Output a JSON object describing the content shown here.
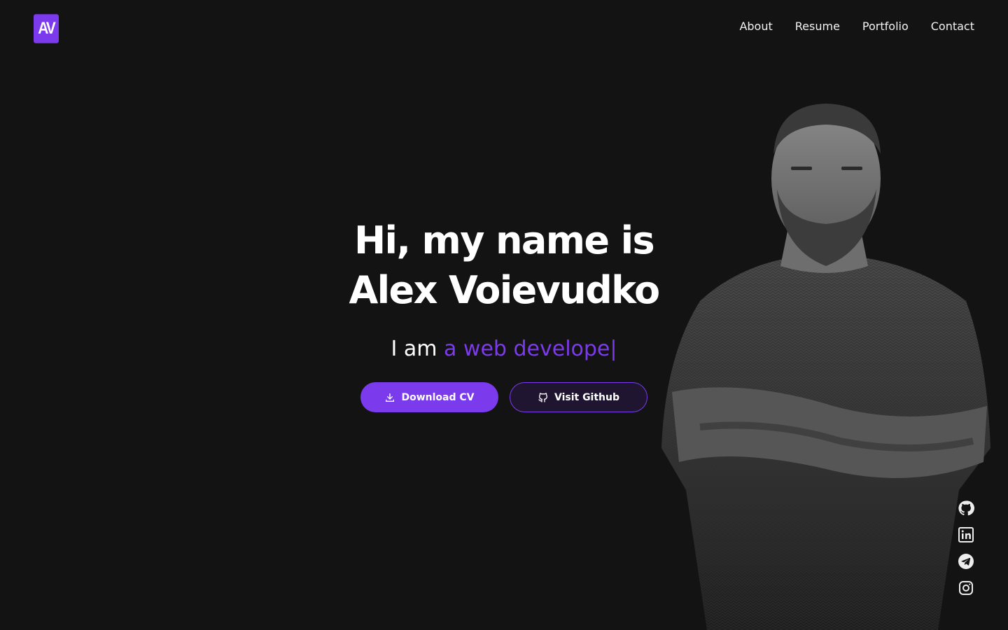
{
  "header": {
    "logo_text": "AV",
    "nav": [
      "About",
      "Resume",
      "Portfolio",
      "Contact"
    ]
  },
  "hero": {
    "title_line1": "Hi, my name is",
    "title_line2": "Alex Voievudko",
    "subtitle_prefix": "I am ",
    "subtitle_typed": "a web develope",
    "subtitle_cursor": "|",
    "download_label": "Download CV",
    "github_label": "Visit Github"
  },
  "socials": [
    "github-icon",
    "linkedin-icon",
    "telegram-icon",
    "instagram-icon"
  ],
  "colors": {
    "background": "#131314",
    "accent": "#7c3aed",
    "text": "#ffffff"
  }
}
